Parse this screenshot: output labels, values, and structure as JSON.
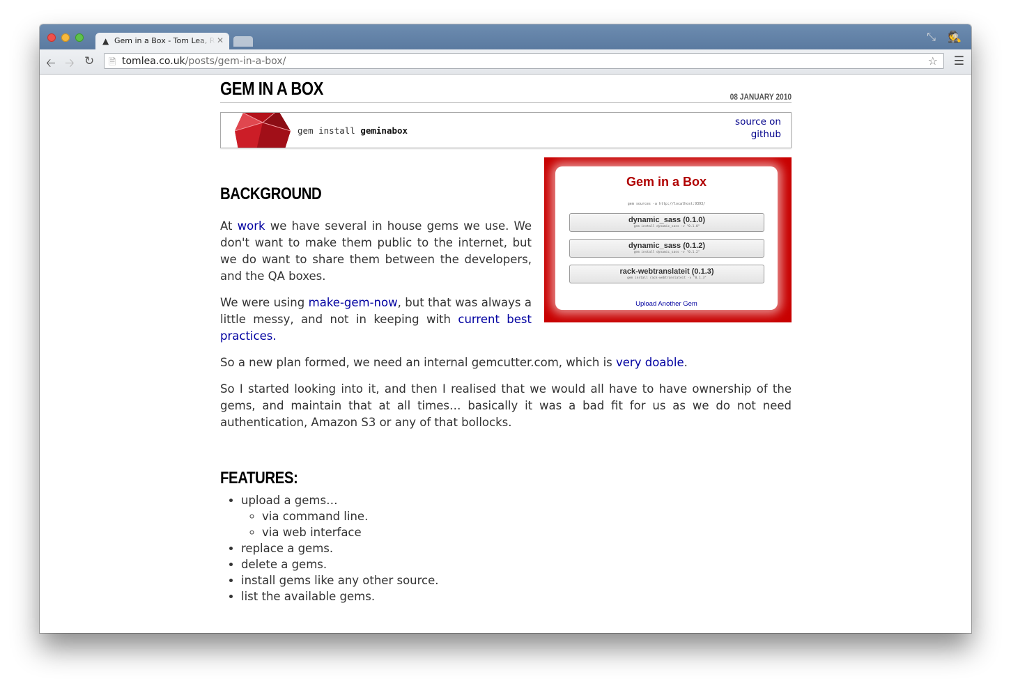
{
  "browser": {
    "tab": {
      "title": "Gem in a Box - Tom Lea, Rails Developer"
    },
    "address": {
      "host": "tomlea.co.uk",
      "path": "/posts/gem-in-a-box/"
    }
  },
  "post": {
    "title": "GEM IN A BOX",
    "date": "08 JANUARY 2010",
    "install": {
      "prefix": "gem install ",
      "name": "geminabox"
    },
    "source_link": "source on github"
  },
  "screenshot": {
    "title": "Gem in a Box",
    "sources_cmd": "gem sources -a http://localhost:9393/",
    "gems": [
      {
        "name": "dynamic_sass (0.1.0)",
        "cmd": "gem install dynamic_sass -v \"0.1.0\""
      },
      {
        "name": "dynamic_sass (0.1.2)",
        "cmd": "gem install dynamic_sass -v \"0.1.2\""
      },
      {
        "name": "rack-webtranslateit (0.1.3)",
        "cmd": "gem install rack-webtranslateit -v \"0.1.3\""
      }
    ],
    "upload_link": "Upload Another Gem"
  },
  "background": {
    "heading": "BACKGROUND",
    "p1": {
      "a": "At ",
      "link": "work",
      "b": " we have several in house gems we use. We don't want to make them public to the internet, but we do want to share them between the developers, and the QA boxes."
    },
    "p2": {
      "a": "We were using ",
      "link1": "make-gem-now",
      "b": ", but that was always a little messy, and not in keeping with ",
      "link2": "current best practices",
      "c": "."
    },
    "p3": {
      "a": "So a new plan formed, we need an internal gemcutter.com, which is ",
      "link": "very doable",
      "b": "."
    },
    "p4": "So I started looking into it, and then I realised that we would all have to have ownership of the gems, and maintain that at all times… basically it was a bad fit for us as we do not need authentication, Amazon S3 or any of that bollocks."
  },
  "features": {
    "heading": "FEATURES:",
    "upload": "upload a gems…",
    "upload_sub": [
      "via command line.",
      "via web interface"
    ],
    "items": [
      "replace a gems.",
      "delete a gems.",
      "install gems like any other source.",
      "list the available gems."
    ]
  }
}
